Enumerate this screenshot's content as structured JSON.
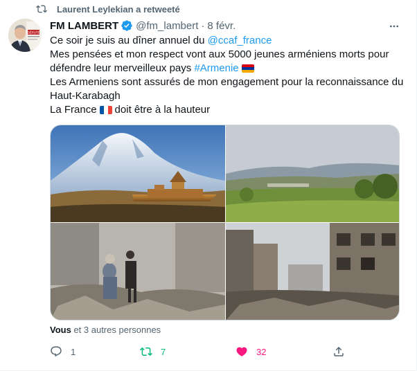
{
  "retweet_context": {
    "label": "Laurent Leylekian a retweeté"
  },
  "tweet": {
    "author_name": "FM LAMBERT",
    "handle": "@fm_lambert",
    "separator": "·",
    "date": "8 févr.",
    "avatar_badge": "DÉPUTÉ",
    "lines": {
      "l1_prefix": "Ce soir je suis au dîner annuel du ",
      "l1_mention": "@ccaf_france",
      "l2": "Mes pensées et mon respect vont aux 5000 jeunes arméniens morts pour",
      "l3_prefix": "défendre leur merveilleux pays ",
      "l3_hashtag": "#Armenie",
      "l4": "Les Armeniens sont assurés de mon engagement pour la reconnaissance du",
      "l5": "Haut-Karabagh",
      "l6_prefix": "La France",
      "l6_suffix": "doit être à la hauteur"
    },
    "flags": {
      "armenia": [
        "#d90012",
        "#0033a0",
        "#f2a800"
      ],
      "france": [
        "#0055a4",
        "#ffffff",
        "#ef4135"
      ]
    },
    "media_images": [
      "mountain-monastery-photo",
      "valley-landscape-photo",
      "rubble-evacuation-photo",
      "destroyed-buildings-photo"
    ],
    "liked_by": {
      "bold": "Vous",
      "rest": " et 3 autres personnes"
    },
    "actions": {
      "replies": "1",
      "retweets": "7",
      "likes": "32"
    }
  },
  "colors": {
    "link": "#1d9bf0",
    "secondary": "#536471",
    "retweet_active": "#00ba7c",
    "like_active": "#f91880",
    "verified": "#1d9bf0"
  }
}
